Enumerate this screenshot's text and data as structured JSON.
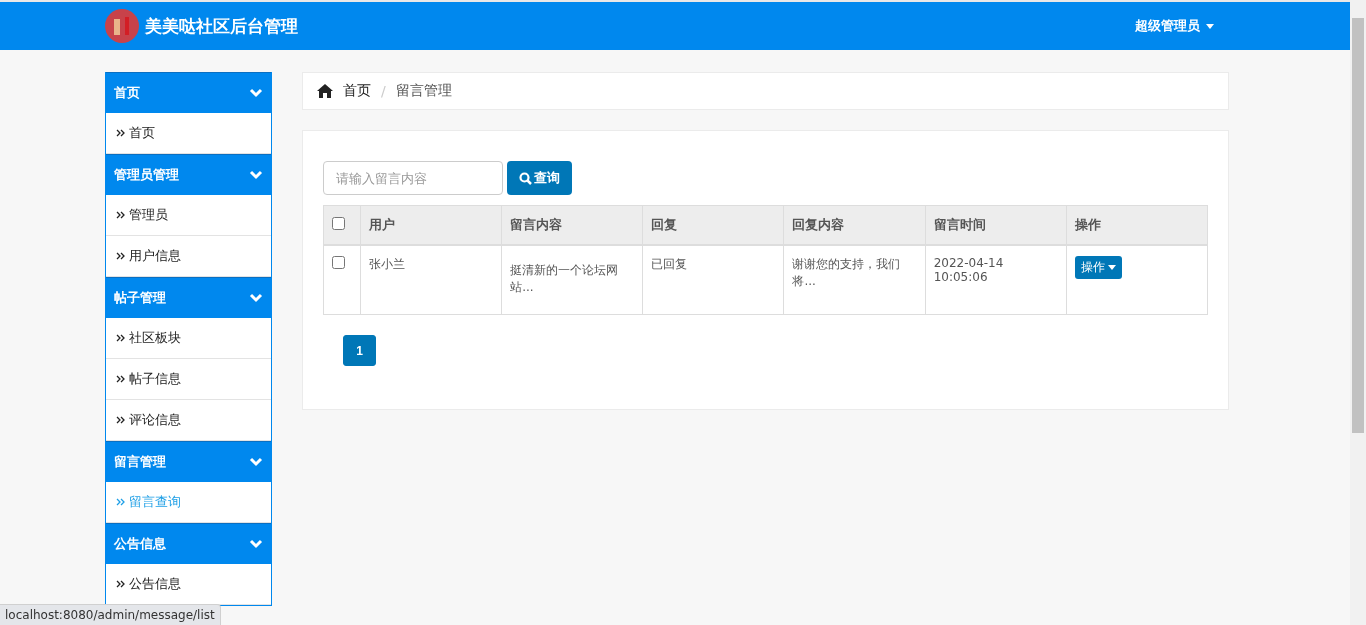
{
  "header": {
    "title": "美美哒社区后台管理",
    "user_menu": "超级管理员"
  },
  "sidebar": {
    "groups": [
      {
        "title": "首页",
        "expanded": true,
        "items": [
          {
            "label": "首页",
            "selected": false
          }
        ]
      },
      {
        "title": "管理员管理",
        "expanded": true,
        "items": [
          {
            "label": "管理员",
            "selected": false
          },
          {
            "label": "用户信息",
            "selected": false
          }
        ]
      },
      {
        "title": "帖子管理",
        "expanded": true,
        "items": [
          {
            "label": "社区板块",
            "selected": false
          },
          {
            "label": "帖子信息",
            "selected": false
          },
          {
            "label": "评论信息",
            "selected": false
          }
        ]
      },
      {
        "title": "留言管理",
        "expanded": true,
        "items": [
          {
            "label": "留言查询",
            "selected": true
          }
        ]
      },
      {
        "title": "公告信息",
        "expanded": true,
        "items": [
          {
            "label": "公告信息",
            "selected": false
          }
        ]
      }
    ]
  },
  "breadcrumb_separator": "/",
  "breadcrumb": [
    {
      "label": "首页"
    },
    {
      "label": "留言管理"
    }
  ],
  "search": {
    "placeholder": "请输入留言内容",
    "button": "查询"
  },
  "table": {
    "select_all_checked": false,
    "columns": [
      "用户",
      "留言内容",
      "回复",
      "回复内容",
      "留言时间",
      "操作"
    ],
    "rows": [
      {
        "checked": false,
        "cells": [
          "张小兰",
          "挺清新的一个论坛网站...",
          "已回复",
          "谢谢您的支持，我们将...",
          "2022-04-14 10:05:06"
        ],
        "action": "操作"
      }
    ]
  },
  "pagination": [
    {
      "label": "1",
      "selected": true
    }
  ],
  "status_bar": "localhost:8080/admin/message/list"
}
